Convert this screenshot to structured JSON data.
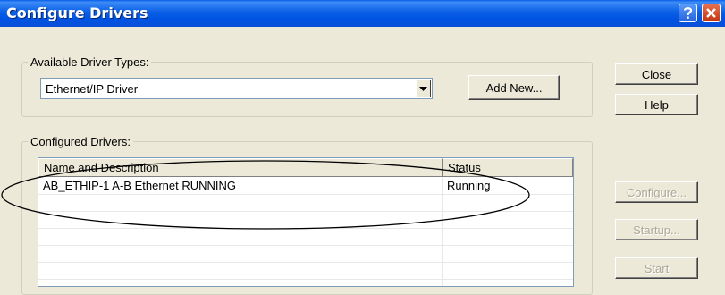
{
  "window": {
    "title": "Configure Drivers"
  },
  "available_driver_types": {
    "legend": "Available Driver Types:",
    "selected": "Ethernet/IP Driver",
    "add_new_label": "Add New..."
  },
  "buttons": {
    "close": "Close",
    "help": "Help",
    "configure": "Configure...",
    "startup": "Startup...",
    "start": "Start"
  },
  "configured_drivers": {
    "legend": "Configured Drivers:",
    "columns": [
      "Name and Description",
      "Status"
    ],
    "rows": [
      {
        "name": "AB_ETHIP-1  A-B Ethernet  RUNNING",
        "status": "Running"
      }
    ]
  }
}
